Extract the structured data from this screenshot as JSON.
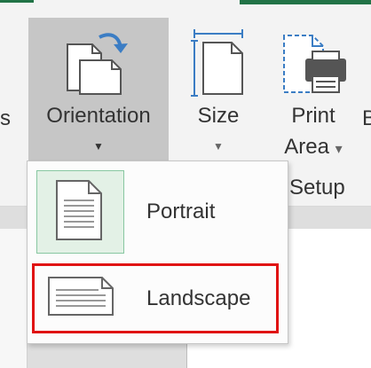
{
  "colors": {
    "accent": "#217346",
    "ribbon_bg": "#f3f3f3",
    "selected_button": "#c6c6c6",
    "portrait_selected_bg": "#e3f1e6",
    "portrait_selected_border": "#88c7a1",
    "highlight_box": "#e01313",
    "icon_blue": "#3b7dc4"
  },
  "ribbon": {
    "cut_left_text": "s",
    "cut_right_text": "B",
    "orientation": {
      "label": "Orientation",
      "caret": "▼",
      "icon": "orientation-icon"
    },
    "size": {
      "label": "Size",
      "caret": "▼",
      "icon": "size-icon"
    },
    "print_area": {
      "label_line1": "Print",
      "label_line2": "Area",
      "caret": "▾",
      "icon": "print-area-icon"
    },
    "group_label": "Setup"
  },
  "dropdown": {
    "items": [
      {
        "label": "Portrait",
        "icon": "portrait-page-icon",
        "selected": true
      },
      {
        "label": "Landscape",
        "icon": "landscape-page-icon",
        "selected": false,
        "highlighted": true
      }
    ]
  }
}
